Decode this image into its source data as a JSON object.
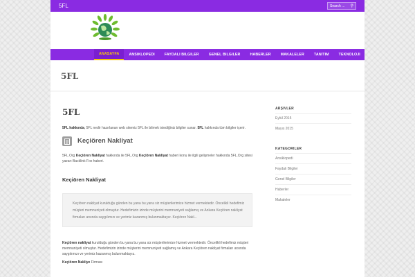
{
  "topbar": {
    "site_name": "5FL",
    "search_placeholder": "Search ..."
  },
  "colors": {
    "accent": "#8a2be2",
    "active_nav": "#f1c40f"
  },
  "nav": {
    "items": [
      "ANASAYFA",
      "ANSIKLOPEDI",
      "FAYDALI BILGILER",
      "GENEL BILGILER",
      "HABERLER",
      "MAKALELER",
      "TANITIM",
      "TEKNOLOJI"
    ],
    "active_index": 0
  },
  "page": {
    "title": "5FL"
  },
  "content": {
    "post_title": "5FL",
    "intro_bold1": "5FL hakkında",
    "intro_text1": ", 5FL nedir hazırlanan web sitemiz 5FL ile bilmek istediğiniz bilgiler sunar. ",
    "intro_bold2": "5FL",
    "intro_text2": " hakkında tüm bilgiler içerir.",
    "entry": {
      "title": "Keçiören Nakliyat",
      "excerpt_1": "5FL.Org ",
      "excerpt_bold1": "Keçiören Nakliyat",
      "excerpt_2": " hakkında ile 5FL.Org ",
      "excerpt_bold2": "Keçiören Nakliyat",
      "excerpt_3": " haberi konu ile ilgili gelişmeler hakkında 5FL.Org sitesi yazarı Backlink Fox haberi.",
      "section_heading": "Keçiören Nakliyat",
      "quote": "Keçiören nakliyat kurulduğu günden bu yana bu yana siz müşterilerimize hizmet vermektedir. Öncelikli hedefimiz müşteri memnuniyeti olmuştur. Hedefimizin izinde müşterini memnuniyeti sağlamış ve Ankara Keçiören nakliyat firmaları arsında saygılımızı ve yerimiz kazanmış bulunmaktayız. Keçiören Nakl...",
      "body_bold": "Keçiören nakliyat",
      "body_text": " kurulduğu günden bu yana bu yana siz müşterilerimize hizmet vermektedir. Öncelikli hedefimiz müşteri memnuniyeti olmuştur. Hedefimizin izinde müşterini memnuniyeti sağlamış ve Ankara Keçiören nakliyat firmaları arsında saygılımızı ve yerimiz kazanmış bulunmaktayız.",
      "tail_bold": "Keçiören Nakliye",
      "tail_text": " Firması"
    }
  },
  "sidebar": {
    "archives_title": "ARŞIVLER",
    "archives": [
      "Eylül 2015",
      "Mayıs 2015"
    ],
    "categories_title": "KATEGORILER",
    "categories": [
      "Ansiklopedi",
      "Faydalı Bilgiler",
      "Genel Bilgiler",
      "Haberler",
      "Makaleler"
    ]
  }
}
